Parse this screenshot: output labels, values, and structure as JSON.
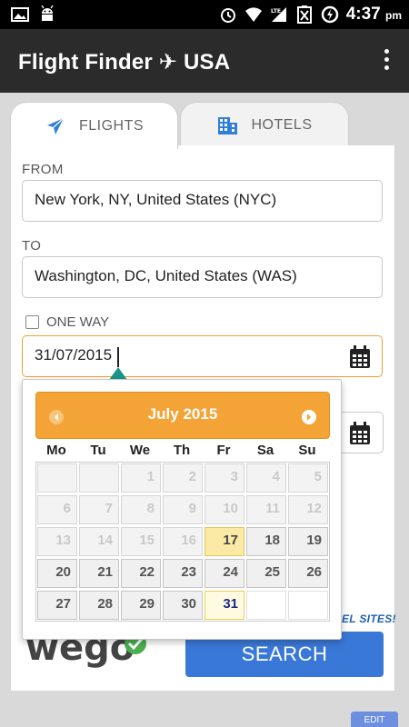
{
  "status_bar": {
    "time": "4:37",
    "ampm": "pm",
    "icons": [
      "image-icon",
      "android-icon",
      "alarm-icon",
      "wifi-icon",
      "lte-signal-icon",
      "battery-icon",
      "sync-icon"
    ]
  },
  "app_bar": {
    "title": "Flight Finder ✈ USA",
    "overflow_icon": "more-vert-icon"
  },
  "tabs": [
    {
      "label": "FLIGHTS",
      "icon": "airplane-icon",
      "active": true
    },
    {
      "label": "HOTELS",
      "icon": "hotel-building-icon",
      "active": false
    }
  ],
  "form": {
    "from_label": "FROM",
    "from_value": "New York, NY, United States (NYC)",
    "to_label": "TO",
    "to_value": "Washington, DC, United States (WAS)",
    "one_way_label": "ONE WAY",
    "one_way_checked": false,
    "depart_date": "31/07/2015",
    "sites_text": "EL SITES!",
    "search_label": "SEARCH",
    "edit_label": "EDIT"
  },
  "datepicker": {
    "month_title": "July 2015",
    "weekdays": [
      "Mo",
      "Tu",
      "We",
      "Th",
      "Fr",
      "Sa",
      "Su"
    ],
    "weeks": [
      [
        "",
        "",
        "1",
        "2",
        "3",
        "4",
        "5"
      ],
      [
        "6",
        "7",
        "8",
        "9",
        "10",
        "11",
        "12"
      ],
      [
        "13",
        "14",
        "15",
        "16",
        "17",
        "18",
        "19"
      ],
      [
        "20",
        "21",
        "22",
        "23",
        "24",
        "25",
        "26"
      ],
      [
        "27",
        "28",
        "29",
        "30",
        "31",
        "",
        ""
      ]
    ],
    "today": "17",
    "selected": "31",
    "first_selectable": "17"
  },
  "colors": {
    "accent_orange": "#f4a436",
    "search_blue": "#3a78d8",
    "app_bar": "#2b2b2b",
    "wego_green": "#4caf50"
  }
}
